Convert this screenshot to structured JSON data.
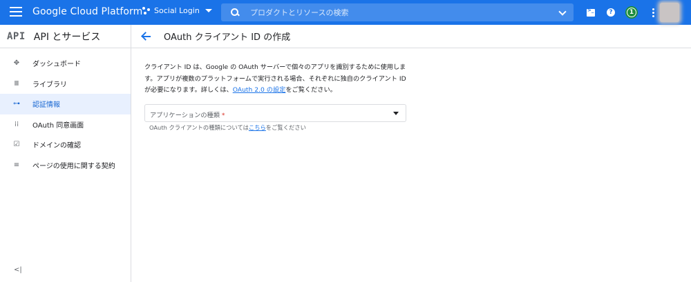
{
  "topbar": {
    "product_name": "Google Cloud Platform",
    "project_name": "Social Login",
    "search_placeholder": "プロダクトとリソースの検索",
    "notification_count": "1"
  },
  "sidebar": {
    "logo": "API",
    "title": "API とサービス",
    "items": [
      {
        "label": "ダッシュボード",
        "icon": "dashboard-icon"
      },
      {
        "label": "ライブラリ",
        "icon": "library-icon"
      },
      {
        "label": "認証情報",
        "icon": "key-icon",
        "active": true
      },
      {
        "label": "OAuth 同意画面",
        "icon": "consent-icon"
      },
      {
        "label": "ドメインの確認",
        "icon": "domain-check-icon"
      },
      {
        "label": "ページの使用に関する契約",
        "icon": "page-usage-icon"
      }
    ],
    "collapse_label": "<|"
  },
  "main": {
    "page_title": "OAuth クライアント ID の作成",
    "description_text": "クライアント ID は、Google の OAuth サーバーで個々のアプリを識別するために使用します。アプリが複数のプラットフォームで実行される場合、それぞれに独自のクライアント ID が必要になります。詳しくは、",
    "description_link": "OAuth 2.0 の設定",
    "description_suffix": "をご覧ください。",
    "app_type_placeholder": "アプリケーションの種類",
    "app_type_required": "*",
    "hint_text": "OAuth クライアントの種類については",
    "hint_link": "こちら",
    "hint_suffix": "をご覧ください"
  },
  "colors": {
    "topbar": "#1a73e8",
    "active_nav_bg": "#e8f0fe",
    "active_nav_text": "#1967d2",
    "link": "#1a73e8",
    "required": "#d93025"
  }
}
